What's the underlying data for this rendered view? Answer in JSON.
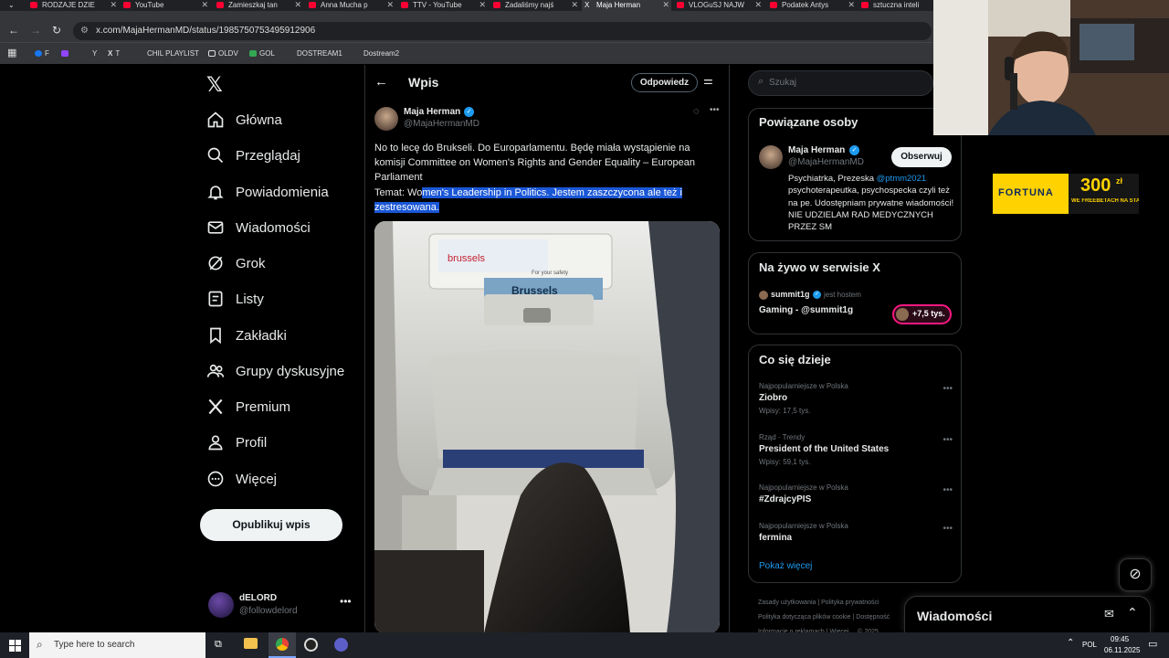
{
  "browser": {
    "tabs": [
      {
        "label": "RODZAJE DZIE"
      },
      {
        "label": "YouTube"
      },
      {
        "label": "Zamieszkaj tan"
      },
      {
        "label": "Anna Mucha p"
      },
      {
        "label": "TTV - YouTube"
      },
      {
        "label": "Zadaliśmy najś"
      },
      {
        "label": "Maja Herman"
      },
      {
        "label": "VLOGuSJ NAJW"
      },
      {
        "label": "Podatek Antys"
      },
      {
        "label": "sztuczna inteli"
      }
    ],
    "url": "x.com/MajaHermanMD/status/1985750753495912906",
    "bookmarks": [
      "F",
      "Y",
      "T",
      "CHIL PLAYLIST",
      "OLDV",
      "GOL",
      "DOSTREAM1",
      "Dostream2"
    ]
  },
  "sidebar": {
    "logo": "x-logo-icon",
    "items": [
      {
        "label": "Główna",
        "icon": "home-icon"
      },
      {
        "label": "Przeglądaj",
        "icon": "search-icon"
      },
      {
        "label": "Powiadomienia",
        "icon": "bell-icon"
      },
      {
        "label": "Wiadomości",
        "icon": "mail-icon"
      },
      {
        "label": "Grok",
        "icon": "grok-icon"
      },
      {
        "label": "Listy",
        "icon": "list-icon"
      },
      {
        "label": "Zakładki",
        "icon": "bookmark-icon"
      },
      {
        "label": "Grupy dyskusyjne",
        "icon": "people-icon"
      },
      {
        "label": "Premium",
        "icon": "x-icon"
      },
      {
        "label": "Profil",
        "icon": "person-icon"
      },
      {
        "label": "Więcej",
        "icon": "more-icon"
      }
    ],
    "post_button": "Opublikuj wpis",
    "account": {
      "name": "dELORD",
      "handle": "@followdelord"
    }
  },
  "main": {
    "title": "Wpis",
    "reply_button": "Odpowiedz",
    "author": {
      "name": "Maja Herman",
      "handle": "@MajaHermanMD"
    },
    "text_plain": "No to lecę do Brukseli. Do Europarlamentu. Będę miała wystąpienie na komisji Committee on Women's Rights and Gender Equality – European Parliament",
    "text_topic_prefix": "Temat: Wo",
    "text_topic_highlighted": "men's Leadership in Politics. Jestem zaszczycona ale też i zestresowana.",
    "image_texts": [
      "brussels",
      "Brussels",
      "For your safety"
    ]
  },
  "right": {
    "search_placeholder": "Szukaj",
    "related": {
      "title": "Powiązane osoby",
      "name": "Maja Herman",
      "handle": "@MajaHermanMD",
      "follow_button": "Obserwuj",
      "bio_prefix": "Psychiatrka, Prezeska ",
      "bio_link": "@ptmm2021",
      "bio_rest": " psychoterapeutka, psychospecka czyli też na pe. Udostępniam prywatne wiadomości! NIE UDZIELAM RAD MEDYCZNYCH PRZEZ SM"
    },
    "live": {
      "title": "Na żywo w serwisie X",
      "host": "summit1g",
      "host_suffix": "jest hostem",
      "stream_title": "Gaming - @summit1g",
      "viewers": "+7,5 tys."
    },
    "trends": {
      "title": "Co się dzieje",
      "items": [
        {
          "meta": "Najpopularniejsze w Polska",
          "name": "Ziobro",
          "count": "Wpisy: 17,5 tys."
        },
        {
          "meta": "Rząd · Trendy",
          "name": "President of the United States",
          "count": "Wpisy: 59,1 tys."
        },
        {
          "meta": "Najpopularniejsze w Polska",
          "name": "#ZdrajcyPIS",
          "count": ""
        },
        {
          "meta": "Najpopularniejsze w Polska",
          "name": "fermina",
          "count": ""
        }
      ],
      "show_more": "Pokaż więcej"
    },
    "footer": [
      "Zasady użytkowania",
      "Polityka prywatności",
      "Polityka dotycząca plików cookie",
      "Dostępność",
      "Informacje o reklamach",
      "Więcej ...",
      "© 2025"
    ],
    "messages_title": "Wiadomości"
  },
  "ad": {
    "brand": "FORTUNA",
    "amount": "300",
    "currency": "zł",
    "tagline": "WE FREEBETACH NA STASZ"
  },
  "taskbar": {
    "search_placeholder": "Type here to search",
    "lang": "POL",
    "time": "09:45",
    "date": "06.11.2025"
  },
  "colors": {
    "accent": "#1d9bf0",
    "highlight": "#1a57d6",
    "live": "#f91880",
    "fortuna": "#ffd200"
  }
}
